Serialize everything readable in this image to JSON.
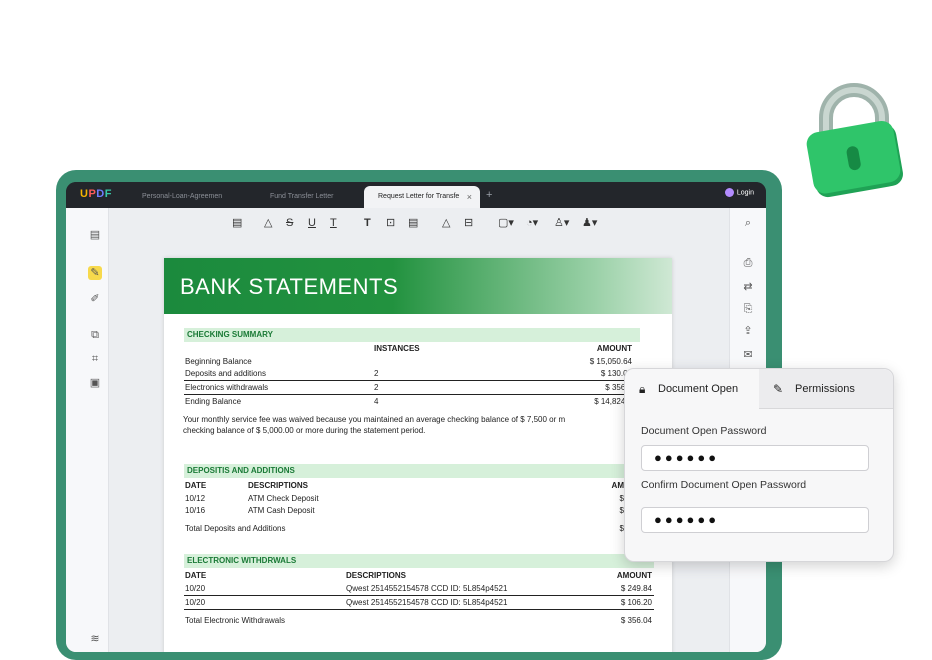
{
  "app": {
    "logo": {
      "u": "U",
      "p": "P",
      "d": "D",
      "f": "F"
    },
    "tabs": [
      {
        "label": "Personal-Loan-Agreemen"
      },
      {
        "label": "Fund Transfer Letter"
      },
      {
        "label": "Request Letter for Transfe"
      }
    ],
    "tab_close": "×",
    "add_tab": "+",
    "login": "Login"
  },
  "toolbar": {
    "strikethrough": "S",
    "underline": "U",
    "text_t": "T",
    "text_tool": "T"
  },
  "document": {
    "title": "BANK STATEMENTS",
    "checking": {
      "heading": "CHECKING SUMMARY",
      "col_instances": "INSTANCES",
      "col_amount": "AMOUNT",
      "rows": [
        {
          "label": "Beginning Balance",
          "instances": "",
          "amount": "$ 15,050.64"
        },
        {
          "label": "Deposits and additions",
          "instances": "2",
          "amount": "$ 130.00"
        },
        {
          "label": "Electronics withdrawals",
          "instances": "2",
          "amount": "$ 356.0"
        },
        {
          "label": "Ending Balance",
          "instances": "4",
          "amount": "$ 14,824.6"
        }
      ],
      "note_line1": "Your monthly service fee was waived because you maintained an average checking balance of $ 7,500 or m",
      "note_line2": "checking balance of $ 5,000.00 or more during the statement period."
    },
    "deposits": {
      "heading": "DEPOSITIS AND ADDITIONS",
      "col_date": "DATE",
      "col_desc": "DESCRIPTIONS",
      "col_amount": "AM",
      "rows": [
        {
          "date": "10/12",
          "desc": "ATM Check Deposit",
          "amount": "$"
        },
        {
          "date": "10/16",
          "desc": "ATM Cash Deposit",
          "amount": "$"
        }
      ],
      "total_label": "Total Deposits and Additions",
      "total_amount": "$"
    },
    "withdrawals": {
      "heading": "ELECTRONIC WITHDRWALS",
      "col_date": "DATE",
      "col_desc": "DESCRIPTIONS",
      "col_amount": "AMOUNT",
      "rows": [
        {
          "date": "10/20",
          "desc": "Qwest 2514552154578 CCD ID: 5L854p4521",
          "amount": "$ 249.84"
        },
        {
          "date": "10/20",
          "desc": "Qwest 2514552154578 CCD ID: 5L854p4521",
          "amount": "$ 106.20"
        }
      ],
      "total_label": "Total Electronic Withdrawals",
      "total_amount": "$ 356.04"
    }
  },
  "security_panel": {
    "tab_open": "Document Open",
    "tab_permissions": "Permissions",
    "password_label": "Document Open Password",
    "password_value": "●●●●●●",
    "confirm_label": "Confirm Document Open Password",
    "confirm_value": "●●●●●●"
  },
  "colors": {
    "device_frame": "#3a8f72",
    "banner_green": "#1b8a3d",
    "section_bg": "#d6f0da",
    "lock_green": "#2fc56a"
  }
}
